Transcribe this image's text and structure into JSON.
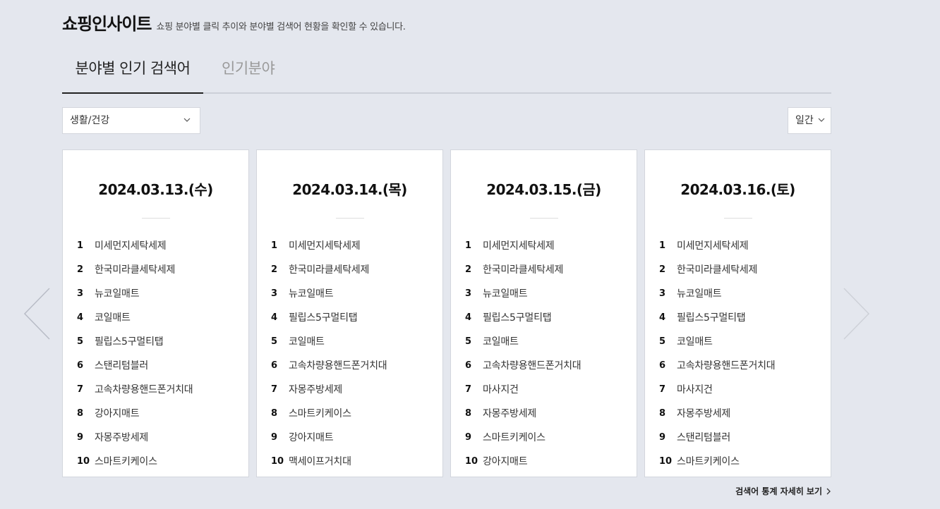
{
  "header": {
    "title": "쇼핑인사이트",
    "description": "쇼핑 분야별 클릭 추이와 분야별 검색어 현황을 확인할 수 있습니다."
  },
  "tabs": [
    {
      "label": "분야별 인기 검색어",
      "active": true
    },
    {
      "label": "인기분야",
      "active": false
    }
  ],
  "category_select": {
    "value": "생활/건강"
  },
  "period_select": {
    "value": "일간"
  },
  "cards": [
    {
      "date": "2024.03.13.(수)",
      "items": [
        {
          "rank": "1",
          "keyword": "미세먼지세탁세제"
        },
        {
          "rank": "2",
          "keyword": "한국미라클세탁세제"
        },
        {
          "rank": "3",
          "keyword": "뉴코일매트"
        },
        {
          "rank": "4",
          "keyword": "코일매트"
        },
        {
          "rank": "5",
          "keyword": "필립스5구멀티탭"
        },
        {
          "rank": "6",
          "keyword": "스탠리텀블러"
        },
        {
          "rank": "7",
          "keyword": "고속차량용핸드폰거치대"
        },
        {
          "rank": "8",
          "keyword": "강아지매트"
        },
        {
          "rank": "9",
          "keyword": "자몽주방세제"
        },
        {
          "rank": "10",
          "keyword": "스마트키케이스"
        }
      ]
    },
    {
      "date": "2024.03.14.(목)",
      "items": [
        {
          "rank": "1",
          "keyword": "미세먼지세탁세제"
        },
        {
          "rank": "2",
          "keyword": "한국미라클세탁세제"
        },
        {
          "rank": "3",
          "keyword": "뉴코일매트"
        },
        {
          "rank": "4",
          "keyword": "필립스5구멀티탭"
        },
        {
          "rank": "5",
          "keyword": "코일매트"
        },
        {
          "rank": "6",
          "keyword": "고속차량용핸드폰거치대"
        },
        {
          "rank": "7",
          "keyword": "자몽주방세제"
        },
        {
          "rank": "8",
          "keyword": "스마트키케이스"
        },
        {
          "rank": "9",
          "keyword": "강아지매트"
        },
        {
          "rank": "10",
          "keyword": "맥세이프거치대"
        }
      ]
    },
    {
      "date": "2024.03.15.(금)",
      "items": [
        {
          "rank": "1",
          "keyword": "미세먼지세탁세제"
        },
        {
          "rank": "2",
          "keyword": "한국미라클세탁세제"
        },
        {
          "rank": "3",
          "keyword": "뉴코일매트"
        },
        {
          "rank": "4",
          "keyword": "필립스5구멀티탭"
        },
        {
          "rank": "5",
          "keyword": "코일매트"
        },
        {
          "rank": "6",
          "keyword": "고속차량용핸드폰거치대"
        },
        {
          "rank": "7",
          "keyword": "마사지건"
        },
        {
          "rank": "8",
          "keyword": "자몽주방세제"
        },
        {
          "rank": "9",
          "keyword": "스마트키케이스"
        },
        {
          "rank": "10",
          "keyword": "강아지매트"
        }
      ]
    },
    {
      "date": "2024.03.16.(토)",
      "items": [
        {
          "rank": "1",
          "keyword": "미세먼지세탁세제"
        },
        {
          "rank": "2",
          "keyword": "한국미라클세탁세제"
        },
        {
          "rank": "3",
          "keyword": "뉴코일매트"
        },
        {
          "rank": "4",
          "keyword": "필립스5구멀티탭"
        },
        {
          "rank": "5",
          "keyword": "코일매트"
        },
        {
          "rank": "6",
          "keyword": "고속차량용핸드폰거치대"
        },
        {
          "rank": "7",
          "keyword": "마사지건"
        },
        {
          "rank": "8",
          "keyword": "자몽주방세제"
        },
        {
          "rank": "9",
          "keyword": "스탠리텀블러"
        },
        {
          "rank": "10",
          "keyword": "스마트키케이스"
        }
      ]
    }
  ],
  "navigation": {
    "prev_icon": "chevron-left-icon",
    "next_icon": "chevron-right-icon"
  },
  "footer": {
    "more_link": "검색어 통계 자세히 보기"
  }
}
